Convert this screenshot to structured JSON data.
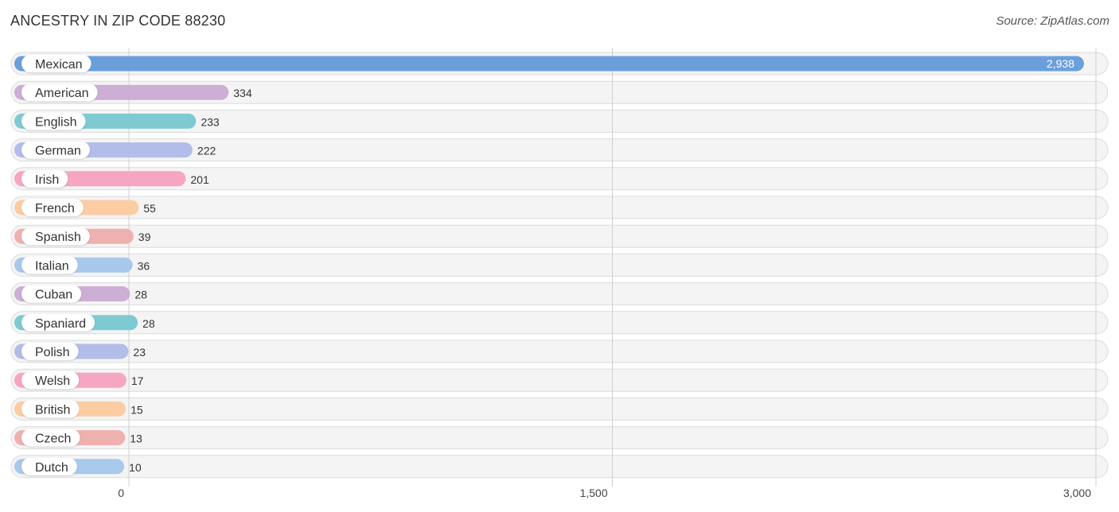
{
  "chart_data": {
    "type": "bar",
    "orientation": "horizontal",
    "title": "ANCESTRY IN ZIP CODE 88230",
    "source": "Source: ZipAtlas.com",
    "xlabel": "",
    "ylabel": "",
    "xlim": [
      0,
      3000
    ],
    "ticks": [
      0,
      1500,
      3000
    ],
    "tick_labels": [
      "0",
      "1,500",
      "3,000"
    ],
    "grid": true,
    "categories": [
      "Mexican",
      "American",
      "English",
      "German",
      "Irish",
      "French",
      "Spanish",
      "Italian",
      "Cuban",
      "Spaniard",
      "Polish",
      "Welsh",
      "British",
      "Czech",
      "Dutch"
    ],
    "values": [
      2938,
      334,
      233,
      222,
      201,
      55,
      39,
      36,
      28,
      28,
      23,
      17,
      15,
      13,
      10
    ],
    "value_labels": [
      "2,938",
      "334",
      "233",
      "222",
      "201",
      "55",
      "39",
      "36",
      "28",
      "28",
      "23",
      "17",
      "15",
      "13",
      "10"
    ],
    "colors": [
      "#6a9fdc",
      "#cdaed4",
      "#7ecad2",
      "#b3bdea",
      "#f6a6c2",
      "#fccda2",
      "#efb0b0",
      "#a8c8ec",
      "#cdaed4",
      "#7ecad2",
      "#b3bdea",
      "#f6a6c2",
      "#fccda2",
      "#efb0b0",
      "#a8c8ec"
    ]
  }
}
